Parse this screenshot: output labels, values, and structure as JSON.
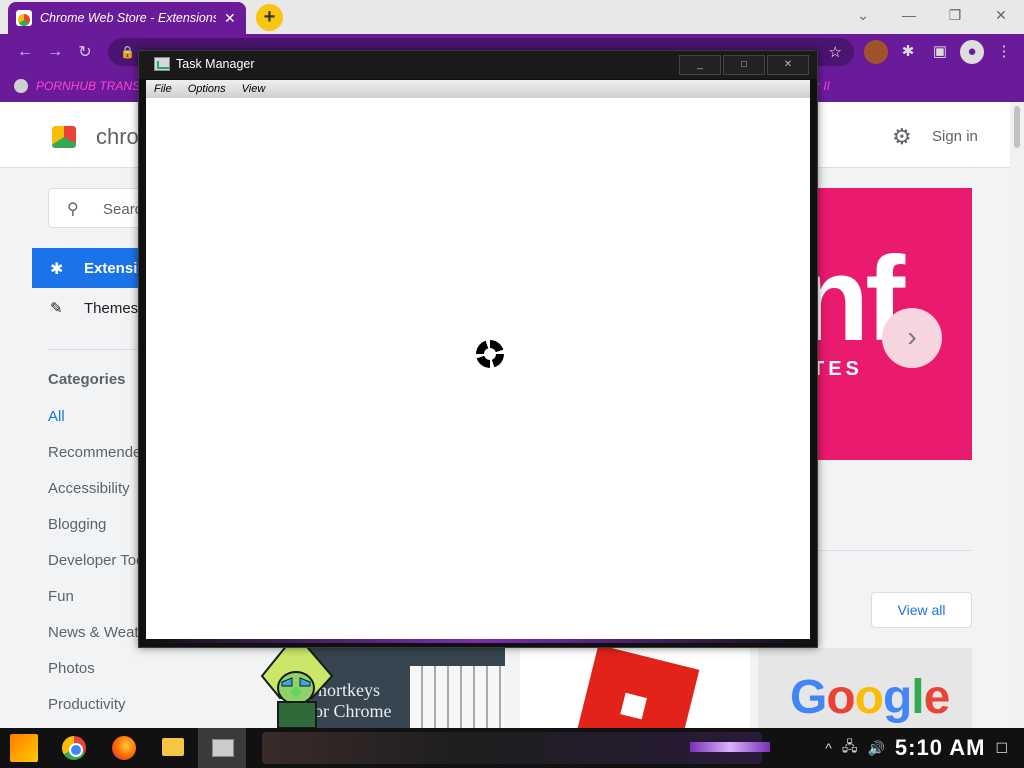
{
  "browser": {
    "tab_title": "Chrome Web Store - Extensions",
    "tab_close": "✕",
    "new_tab": "+",
    "window_min": "—",
    "window_restore": "❐",
    "window_close": "✕",
    "toolbar_back": "←",
    "toolbar_forward": "→",
    "toolbar_reload": "↻",
    "bookmark_left": "PORNHUB TRANS",
    "bookmark_right": "ter II"
  },
  "store": {
    "name": "chro",
    "signin": "Sign in",
    "search_placeholder": "Searc",
    "nav_extensions": "Extensic",
    "nav_themes": "Themes",
    "categories_heading": "Categories",
    "categories": [
      "All",
      "Recommende",
      "Accessibility",
      "Blogging",
      "Developer Too",
      "Fun",
      "News & Weath",
      "Photos",
      "Productivity"
    ],
    "banner_text": "nf",
    "banner_sub": "TES",
    "view_all": "View all",
    "tile_shortkeys": "Shortkeys\nfor Chrome",
    "tile_google": "Google"
  },
  "task_manager": {
    "title": "Task Manager",
    "menu": [
      "File",
      "Options",
      "View"
    ],
    "ctrl_min": "_",
    "ctrl_max": "□",
    "ctrl_close": "✕"
  },
  "taskbar": {
    "clock": "5:10 AM",
    "tray_chevron": "^",
    "tray_network": "🖧",
    "tray_volume": "🔊",
    "tray_notifications": "☐"
  },
  "colors": {
    "theme_purple": "#6a1b9a",
    "bookmark_pink": "#ff44cc",
    "accent_blue": "#1a73e8",
    "banner_pink": "#ea1a6e"
  }
}
